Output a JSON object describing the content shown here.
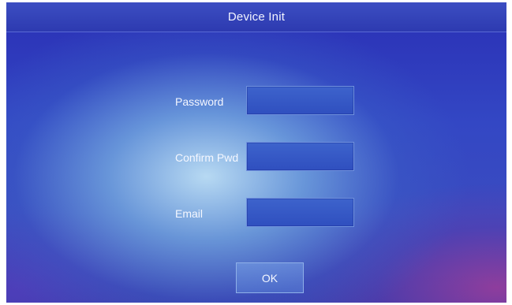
{
  "header": {
    "title": "Device Init"
  },
  "form": {
    "password_label": "Password",
    "password_value": "",
    "confirm_label": "Confirm Pwd",
    "confirm_value": "",
    "email_label": "Email",
    "email_value": ""
  },
  "actions": {
    "ok_label": "OK"
  },
  "colors": {
    "background": "#2f3fb8",
    "field_fill": "#3556c4",
    "field_border": "#6f90dd",
    "text": "#f4f7ff"
  }
}
